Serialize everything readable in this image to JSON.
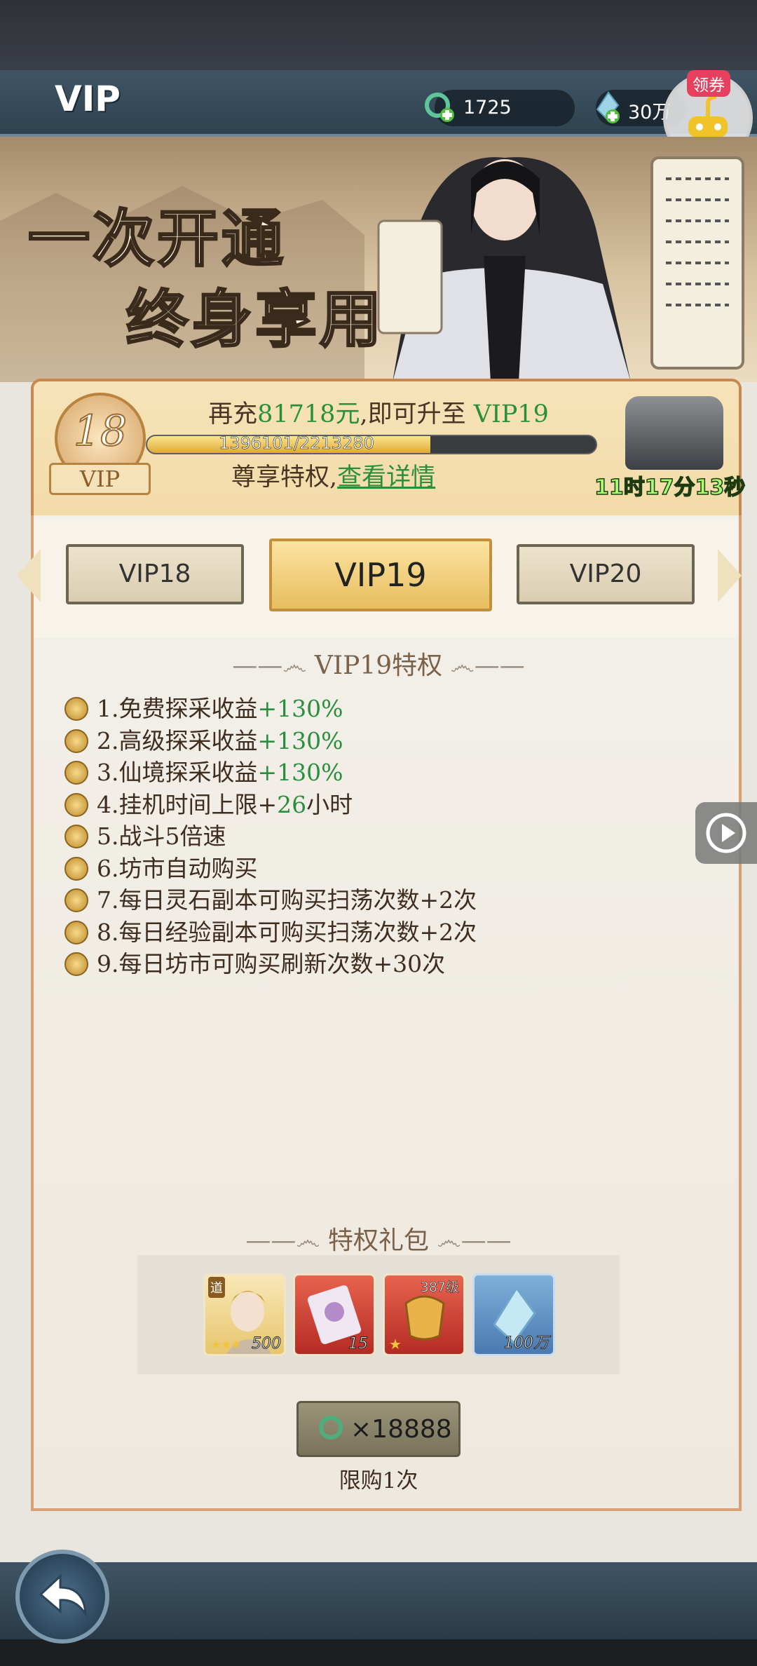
{
  "header": {
    "title": "VIP",
    "currency_jade": "1725",
    "currency_crystal": "30万",
    "coupon_label": "领券"
  },
  "banner": {
    "line1": "一次开通",
    "line2": "终身享用"
  },
  "vip_status": {
    "current_level": "18",
    "badge_label": "VIP",
    "recharge_prefix": "再充",
    "recharge_amount": "81718元",
    "recharge_middle": ",即可升至 ",
    "next_level": "VIP19",
    "progress_text": "1396101/2213280",
    "progress_fraction": 0.6308,
    "privilege_prefix": "尊享特权,",
    "detail_link": "查看详情",
    "timer": "11时17分13秒"
  },
  "tabs": [
    {
      "label": "VIP18"
    },
    {
      "label": "VIP19"
    },
    {
      "label": "VIP20"
    }
  ],
  "privileges": {
    "title": "VIP19特权",
    "items": [
      {
        "text": "1.免费探采收益",
        "highlight": "+130%",
        "suffix": ""
      },
      {
        "text": "2.高级探采收益",
        "highlight": "+130%",
        "suffix": ""
      },
      {
        "text": "3.仙境探采收益",
        "highlight": "+130%",
        "suffix": ""
      },
      {
        "text": "4.挂机时间上限+",
        "highlight": "26",
        "suffix": "小时"
      },
      {
        "text": "5.战斗5倍速",
        "highlight": "",
        "suffix": ""
      },
      {
        "text": "6.坊市自动购买",
        "highlight": "",
        "suffix": ""
      },
      {
        "text": "7.每日灵石副本可购买扫荡次数+2次",
        "highlight": "",
        "suffix": ""
      },
      {
        "text": "8.每日经验副本可购买扫荡次数+2次",
        "highlight": "",
        "suffix": ""
      },
      {
        "text": "9.每日坊市可购买刷新次数+30次",
        "highlight": "",
        "suffix": ""
      }
    ]
  },
  "gift": {
    "title": "特权礼包",
    "items": [
      {
        "tag": "道",
        "count": "500"
      },
      {
        "tag": "",
        "count": "15"
      },
      {
        "tag": "387级",
        "count": ""
      },
      {
        "tag": "",
        "count": "100万"
      }
    ],
    "price": "×18888",
    "limit": "限购1次"
  },
  "colors": {
    "accent_green": "#2a8f3c",
    "timer_green": "#a6ff6b",
    "panel_border": "#c8884e"
  }
}
